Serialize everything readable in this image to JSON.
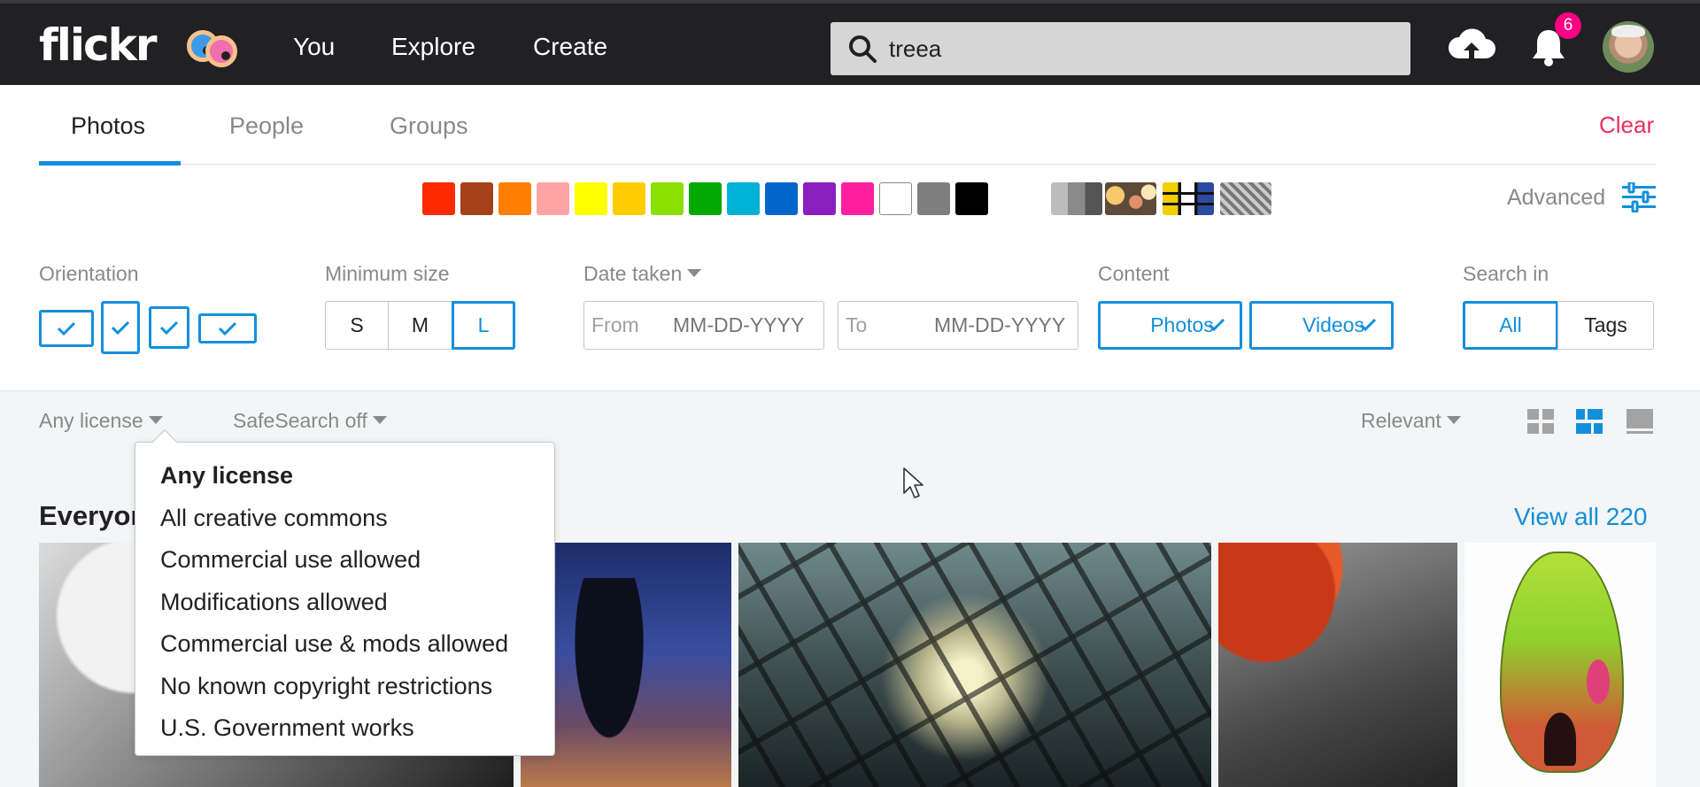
{
  "header": {
    "logo": "flickr",
    "nav": [
      "You",
      "Explore",
      "Create"
    ],
    "search": {
      "value": "treea",
      "placeholder": "Search"
    },
    "notifications_count": "6"
  },
  "tabs": {
    "items": [
      "Photos",
      "People",
      "Groups"
    ],
    "active": "Photos",
    "clear_label": "Clear"
  },
  "color_filters": [
    "#ff2a00",
    "#a5411a",
    "#ff7f00",
    "#ffa4a4",
    "#ffff00",
    "#ffcc00",
    "#8be000",
    "#00a800",
    "#00b1d6",
    "#0066cc",
    "#8b1ebe",
    "#ff1e9e",
    "#ffffff",
    "#7f7f7f",
    "#000000"
  ],
  "style_filters": [
    "black-and-white",
    "shallow-depth-of-field",
    "pattern",
    "minimalist"
  ],
  "advanced_label": "Advanced",
  "filters": {
    "orientation_label": "Orientation",
    "min_size_label": "Minimum size",
    "sizes": [
      "S",
      "M",
      "L"
    ],
    "selected_size": "L",
    "date_taken_label": "Date taken",
    "date_from_prefix": "From",
    "date_to_prefix": "To",
    "date_placeholder": "MM-DD-YYYY",
    "content_label": "Content",
    "content_options": [
      "Photos",
      "Videos"
    ],
    "search_in_label": "Search in",
    "search_in_options": [
      "All",
      "Tags"
    ],
    "search_in_selected": "All"
  },
  "toolbar": {
    "license_label": "Any license",
    "safesearch_label": "SafeSearch off",
    "sort_label": "Relevant"
  },
  "license_dropdown": {
    "options": [
      "Any license",
      "All creative commons",
      "Commercial use allowed",
      "Modifications allowed",
      "Commercial use & mods allowed",
      "No known copyright restrictions",
      "U.S. Government works"
    ],
    "selected": "Any license"
  },
  "results": {
    "section_title": "Everyon",
    "view_all_label": "View all 220"
  },
  "colors": {
    "accent": "#128fdc",
    "clear": "#e8305b",
    "badge": "#ff0084",
    "topbar": "#212124"
  }
}
